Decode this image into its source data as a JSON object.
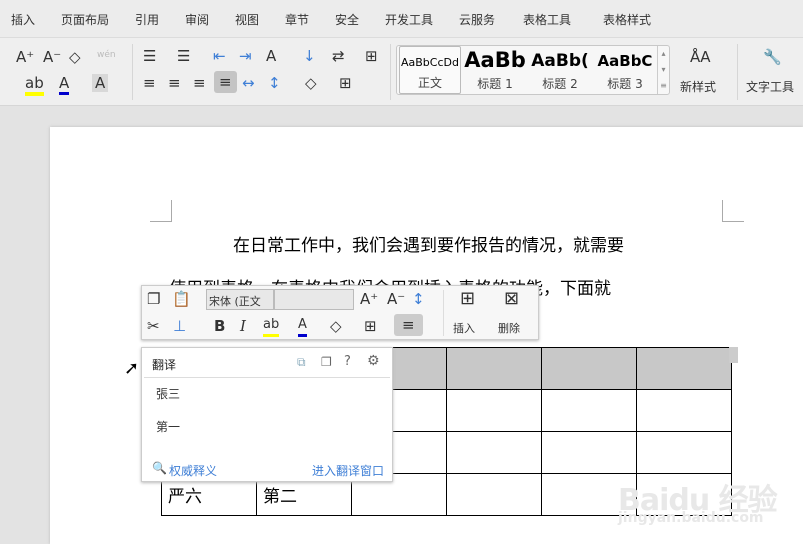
{
  "menu": [
    "插入",
    "页面布局",
    "引用",
    "审阅",
    "视图",
    "章节",
    "安全",
    "开发工具",
    "云服务",
    "表格工具",
    "表格样式"
  ],
  "ribbon": {
    "styles": [
      {
        "sample": "AaBbCcDd",
        "label": "正文"
      },
      {
        "sample": "AaBb",
        "label": "标题 1"
      },
      {
        "sample": "AaBb(",
        "label": "标题 2"
      },
      {
        "sample": "AaBbC",
        "label": "标题 3"
      }
    ],
    "new_style": "新样式",
    "text_tools": "文字工具",
    "phonetic": "wén"
  },
  "document": {
    "line1": "在日常工作中，我们会遇到要作报告的情况，就需要",
    "line2": "使用到表格，在表格中我们会用到插入表格的功能，下面就",
    "table": [
      [
        "",
        "",
        "",
        "",
        "",
        ""
      ],
      [
        "",
        "",
        "",
        "",
        "",
        ""
      ],
      [
        "",
        "",
        "",
        "",
        "",
        ""
      ],
      [
        "严六",
        "第二",
        "",
        "",
        "",
        ""
      ]
    ]
  },
  "mini_toolbar": {
    "font": "宋体 (正文",
    "size": "",
    "insert": "插入",
    "delete": "删除"
  },
  "translate": {
    "title": "翻译",
    "results": [
      "張三",
      "第一"
    ],
    "authority": "权威释义",
    "open_window": "进入翻译窗口"
  },
  "watermark": {
    "brand": "Bai du 经验",
    "url": "jingyan.baidu.com"
  },
  "colors": {
    "highlight": "#ffff00",
    "font_color": "#0000cc",
    "link": "#3f7fd6"
  }
}
